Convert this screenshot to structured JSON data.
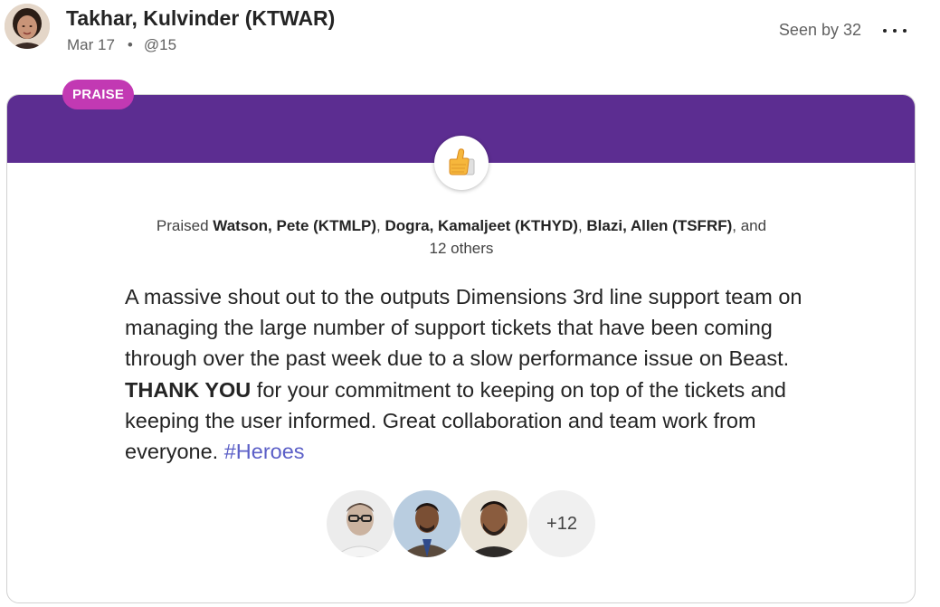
{
  "post": {
    "author": "Takhar, Kulvinder (KTWAR)",
    "date": "Mar 17",
    "separator": "•",
    "mention": "@15",
    "seen_by": "Seen by 32",
    "more_icon": "ellipsis-horizontal-icon"
  },
  "praise": {
    "badge": "PRAISE",
    "icon": "thumbs-up-icon",
    "praised_prefix": "Praised ",
    "people": [
      "Watson, Pete (KTMLP)",
      "Dogra, Kamaljeet (KTHYD)",
      "Blazi, Allen (TSFRF)"
    ],
    "sep1": ", ",
    "sep2": ", ",
    "sep3": ", and",
    "others": "12 others",
    "message_part1": "A massive shout out to the outputs Dimensions 3rd line support team on managing the large number of support tickets that have been coming through over the past week due to a slow performance issue on Beast.  ",
    "message_bold": "THANK YOU",
    "message_part2": " for your commitment to keeping on top of the tickets and keeping the user informed.  Great collaboration and team work from everyone.  ",
    "hashtag": "#Heroes",
    "more_count": "+12"
  },
  "colors": {
    "banner": "#5c2d91",
    "badge": "#c239b3",
    "hashtag": "#5b5fc7"
  }
}
